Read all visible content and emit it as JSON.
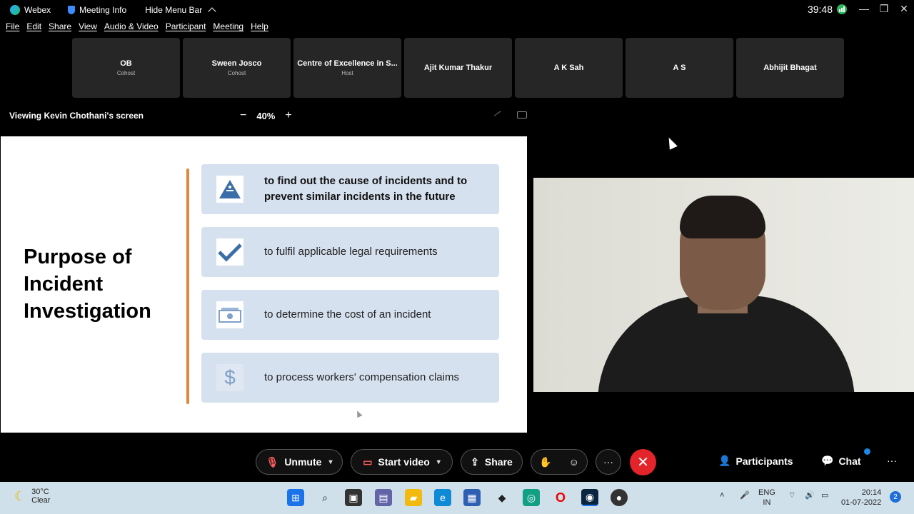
{
  "titlebar": {
    "app_name": "Webex",
    "meeting_info": "Meeting Info",
    "hide_menu_bar": "Hide Menu Bar",
    "timer": "39:48"
  },
  "menu": [
    "File",
    "Edit",
    "Share",
    "View",
    "Audio & Video",
    "Participant",
    "Meeting",
    "Help"
  ],
  "participants": [
    {
      "name": "OB",
      "role": "Cohost"
    },
    {
      "name": "Sween Josco",
      "role": "Cohost"
    },
    {
      "name": "Centre of Excellence in S...",
      "role": "Host"
    },
    {
      "name": "Ajit Kumar Thakur",
      "role": ""
    },
    {
      "name": "A K Sah",
      "role": ""
    },
    {
      "name": "A S",
      "role": ""
    },
    {
      "name": "Abhijit Bhagat",
      "role": ""
    }
  ],
  "viewing": {
    "label": "Viewing Kevin Chothani's screen",
    "zoom": "40%",
    "minus": "−",
    "plus": "+"
  },
  "slide": {
    "title": "Purpose of Incident Investigation",
    "items": [
      {
        "icon": "warning-icon",
        "text": "to find out the cause of incidents and to prevent similar incidents in the future"
      },
      {
        "icon": "checkmark-icon",
        "text": "to fulfil applicable legal requirements"
      },
      {
        "icon": "money-icon",
        "text": "to determine the cost of an incident"
      },
      {
        "icon": "dollar-icon",
        "text": "to process workers' compensation claims"
      }
    ]
  },
  "controls": {
    "unmute": "Unmute",
    "start_video": "Start video",
    "share": "Share",
    "participants": "Participants",
    "chat": "Chat",
    "more": "···",
    "end": "✕"
  },
  "taskbar": {
    "temperature": "30°C",
    "condition": "Clear",
    "lang_top": "ENG",
    "lang_bottom": "IN",
    "time": "20:14",
    "date": "01-07-2022",
    "notifications": "2"
  },
  "colors": {
    "accent_orange": "#e0873a",
    "card_blue": "#d6e1ef",
    "end_red": "#e3242b",
    "icon_blue": "#3b6ea8"
  }
}
